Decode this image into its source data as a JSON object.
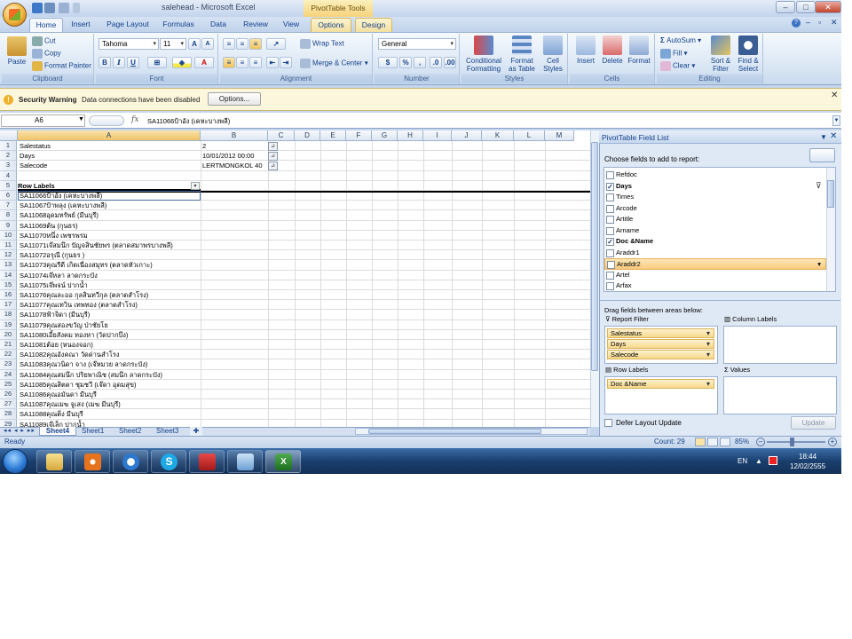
{
  "window": {
    "title": "salehead - Microsoft Excel",
    "context_tab": "PivotTable Tools",
    "min": "–",
    "max": "□",
    "close": "✕"
  },
  "tabs": [
    "Home",
    "Insert",
    "Page Layout",
    "Formulas",
    "Data",
    "Review",
    "View",
    "Options",
    "Design"
  ],
  "ribbon": {
    "clipboard": {
      "label": "Clipboard",
      "paste": "Paste",
      "cut": "Cut",
      "copy": "Copy",
      "format_painter": "Format Painter"
    },
    "font": {
      "label": "Font",
      "name": "Tahoma",
      "size": "11"
    },
    "alignment": {
      "label": "Alignment",
      "wrap": "Wrap Text",
      "merge": "Merge & Center"
    },
    "number": {
      "label": "Number",
      "format": "General"
    },
    "styles": {
      "label": "Styles",
      "cond": "Conditional Formatting",
      "table": "Format as Table",
      "cell": "Cell Styles"
    },
    "cells": {
      "label": "Cells",
      "insert": "Insert",
      "delete": "Delete",
      "format": "Format"
    },
    "editing": {
      "label": "Editing",
      "autosum": "AutoSum",
      "fill": "Fill",
      "clear": "Clear",
      "sort": "Sort & Filter",
      "find": "Find & Select"
    }
  },
  "security": {
    "title": "Security Warning",
    "message": "Data connections have been disabled",
    "options": "Options..."
  },
  "formula": {
    "namebox": "A6",
    "fx": "fx",
    "value": "SA11066ป้าอัง (เคหะบางพลี)"
  },
  "columns": [
    "A",
    "B",
    "C",
    "D",
    "E",
    "F",
    "G",
    "H",
    "I",
    "J",
    "K",
    "L",
    "M"
  ],
  "filters": [
    {
      "row": "1",
      "label": "Salestatus",
      "value": "2"
    },
    {
      "row": "2",
      "label": "Days",
      "value": "10/01/2012 00:00"
    },
    {
      "row": "3",
      "label": "Salecode",
      "value": "LERTMONGKOL 40"
    }
  ],
  "row_labels_header": "Row Labels",
  "rows": [
    "SA11066ป้าอัง (เคหะบางพลี)",
    "SA11067ป้าพลุง (เคหะบางพลี)",
    "SA11068อุดมทรัพย์ (มีนบุรี)",
    "SA11069ต้น (กุนธร)",
    "SA11070หนึ่ง  เพชรพรม",
    "SA11071เจ๊สมนึก  ปัญจสินชัยพร (ตลาดสมาพรบางพลี)",
    "SA11072อรุณี (กุนธร )",
    "SA11073คุณรีดี  เกิดเนื่องสมุทร (ตลาดหัวเกาะ)",
    "SA11074เจ๊หลา  ลาดกระบัง",
    "SA11075เจ๊พจน์    ปากน้ำ",
    "SA11076คุณละออ  กุลสินทวีกุล (ตลาดสำโรง)",
    "SA11077คุณเทวิน  เทพทอง (ตลาดสำโรง)",
    "SA11078ฟ้าจิดา (มีนบุรี)",
    "SA11079คุณสองขวัญ  ป่าชัยโย",
    "SA11080เอี้ยสังคม  ทองหา (วัดปากบึง)",
    "SA11081ต้อย (หนองจอก)",
    "SA11082คุณอังคณา  วัดด่านสำโรง",
    "SA11083คุณวนิดา  จาง (เจ๊หมวย ลาดกระบัง)",
    "SA11084คุณสมนึก  ปริยพาณิช (สมนึก ลาดกระบัง)",
    "SA11085คุณสิตดา  ชุมชวี (เจ๊ดา อุดมสุข)",
    "SA11086คุณอมันดา  มีนบุรี",
    "SA11087คุณเมฆ  จูเสง (เมฆ มีนบุรี)",
    "SA11088คุณติ่ง  มีนบุรี",
    "SA11089เจ๊เล็ก  ปากน้ำ"
  ],
  "sheets": [
    "Sheet4",
    "Sheet1",
    "Sheet2",
    "Sheet3"
  ],
  "status": {
    "ready": "Ready",
    "count": "Count: 29",
    "zoom": "85%"
  },
  "pivot": {
    "title": "PivotTable Field List",
    "choose": "Choose fields to add to report:",
    "fields": [
      {
        "name": "Refdoc",
        "checked": false
      },
      {
        "name": "Days",
        "checked": true
      },
      {
        "name": "Times",
        "checked": false
      },
      {
        "name": "Arcode",
        "checked": false
      },
      {
        "name": "Artitle",
        "checked": false
      },
      {
        "name": "Arname",
        "checked": false
      },
      {
        "name": "Doc &Name",
        "checked": true
      },
      {
        "name": "Araddr1",
        "checked": false
      },
      {
        "name": "Araddr2",
        "checked": false
      },
      {
        "name": "Artel",
        "checked": false
      },
      {
        "name": "Arfax",
        "checked": false
      }
    ],
    "drag_label": "Drag fields between areas below:",
    "report_filter": "Report Filter",
    "column_labels": "Column Labels",
    "row_labels": "Row Labels",
    "values": "Values",
    "filter_items": [
      "Salestatus",
      "Days",
      "Salecode"
    ],
    "row_items": [
      "Doc &Name"
    ],
    "defer": "Defer Layout Update",
    "update": "Update"
  },
  "taskbar": {
    "lang": "EN",
    "time": "18:44",
    "date": "12/02/2555"
  }
}
